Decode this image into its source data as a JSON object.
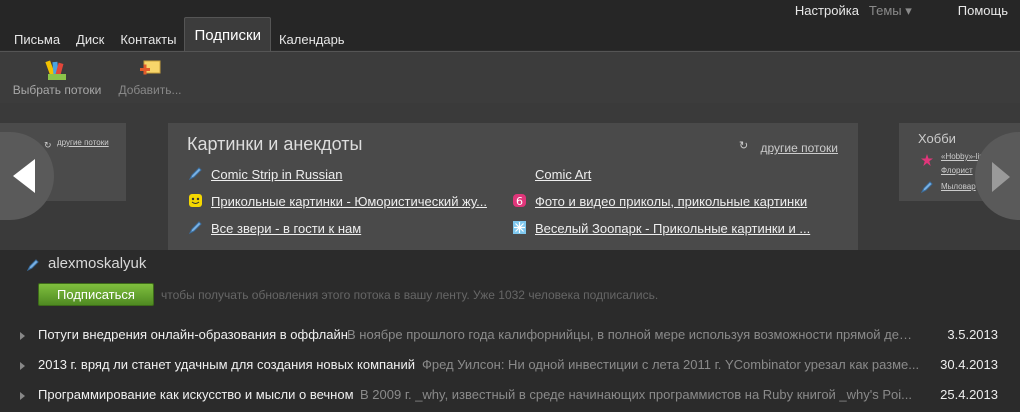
{
  "header": {
    "settings": "Настройка",
    "themes": "Темы ▾",
    "help": "Помощь"
  },
  "tabs": [
    {
      "label": "Письма"
    },
    {
      "label": "Диск"
    },
    {
      "label": "Контакты"
    },
    {
      "label": "Подписки",
      "active": true
    },
    {
      "label": "Календарь"
    }
  ],
  "toolbar": {
    "choose_label": "Выбрать потоки",
    "add_label": "Добавить..."
  },
  "carousel": {
    "left_card": {
      "other_streams": "другие потоки"
    },
    "main": {
      "title": "Картинки и анекдоты",
      "other_streams": "другие потоки",
      "feeds": [
        {
          "label": "Comic Strip in Russian",
          "icon": "pencil-icon"
        },
        {
          "label": "Comic Art",
          "icon": ""
        },
        {
          "label": "Прикольные картинки - Юмористический жу...",
          "icon": "smiley-icon"
        },
        {
          "label": "Фото и видео приколы, прикольные картинки",
          "icon": "pink-six-icon"
        },
        {
          "label": "Все звери - в гости к нам",
          "icon": "pencil-icon"
        },
        {
          "label": "Веселый Зоопарк - Прикольные картинки и ...",
          "icon": "snowflake-icon"
        }
      ]
    },
    "right_card": {
      "title": "Хобби",
      "items": [
        "«Hobby»-lin",
        "Флорист",
        "Мыловар"
      ]
    }
  },
  "feed": {
    "author": "alexmoskalyuk",
    "subscribe_label": "Подписаться",
    "subscribe_note": "чтобы получать обновления этого потока в вашу ленту. Уже 1032 человека подписались.",
    "posts": [
      {
        "title": "Потуги внедрения онлайн-образования в оффлайн",
        "excerpt": "В ноябре прошлого года калифорнийцы, в полной мере используя возможности прямой дем...",
        "date": "3.5.2013"
      },
      {
        "title": "2013 г. вряд ли станет удачным для создания новых компаний",
        "excerpt": "Фред Уилсон: Ни одной инвестиции с лета 2011 г. YCombinator урезал как разме...",
        "date": "30.4.2013"
      },
      {
        "title": "Программирование как искусство и мысли о вечном",
        "excerpt": "В 2009 г. _why, известный в среде начинающих программистов на Ruby книгой _why's Poi...",
        "date": "25.4.2013"
      }
    ]
  }
}
